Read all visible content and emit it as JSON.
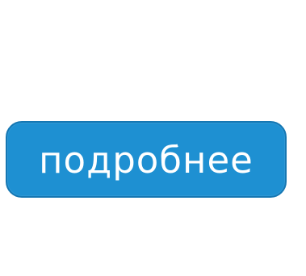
{
  "button": {
    "label": "подробнее",
    "background_color": "#1e90d2",
    "border_color": "#1577b3",
    "text_color": "#ffffff"
  }
}
